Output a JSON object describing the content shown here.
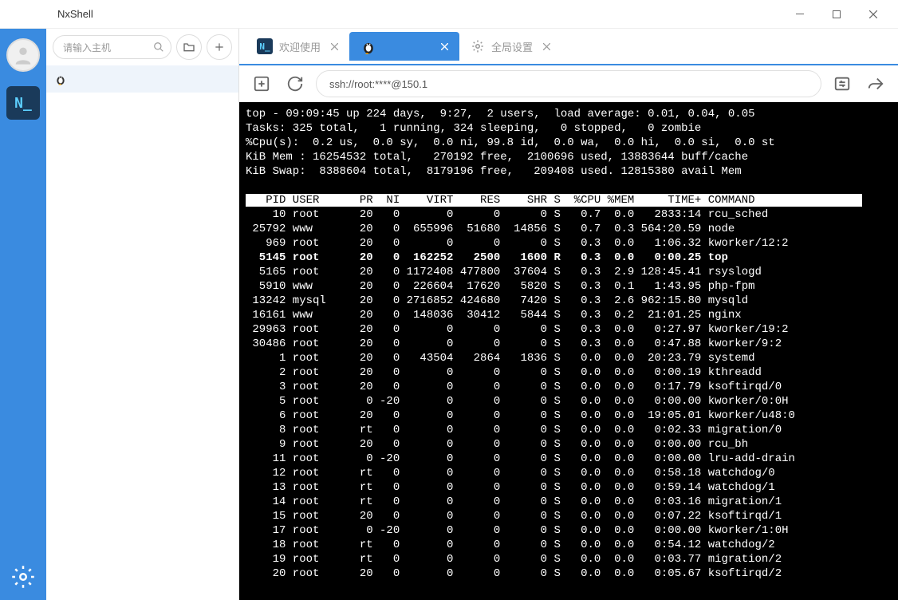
{
  "window": {
    "title": "NxShell"
  },
  "hostpanel": {
    "search_placeholder": "请输入主机",
    "host_item": ""
  },
  "tabs": {
    "welcome": "欢迎使用",
    "session": "",
    "global": "全局设置"
  },
  "address": "ssh://root:****@150.1",
  "term": {
    "summary1": "top - 09:09:45 up 224 days,  9:27,  2 users,  load average: 0.01, 0.04, 0.05",
    "summary2": "Tasks: 325 total,   1 running, 324 sleeping,   0 stopped,   0 zombie",
    "summary3": "%Cpu(s):  0.2 us,  0.0 sy,  0.0 ni, 99.8 id,  0.0 wa,  0.0 hi,  0.0 si,  0.0 st",
    "summary4": "KiB Mem : 16254532 total,   270192 free,  2100696 used, 13883644 buff/cache",
    "summary5": "KiB Swap:  8388604 total,  8179196 free,   209408 used. 12815380 avail Mem",
    "header": "   PID USER      PR  NI    VIRT    RES    SHR S  %CPU %MEM     TIME+ COMMAND                ",
    "rows": [
      "    10 root      20   0       0      0      0 S   0.7  0.0   2833:14 rcu_sched",
      " 25792 www       20   0  655996  51680  14856 S   0.7  0.3 564:20.59 node",
      "   969 root      20   0       0      0      0 S   0.3  0.0   1:06.32 kworker/12:2",
      "  5145 root      20   0  162252   2500   1600 R   0.3  0.0   0:00.25 top",
      "  5165 root      20   0 1172408 477800  37604 S   0.3  2.9 128:45.41 rsyslogd",
      "  5910 www       20   0  226604  17620   5820 S   0.3  0.1   1:43.95 php-fpm",
      " 13242 mysql     20   0 2716852 424680   7420 S   0.3  2.6 962:15.80 mysqld",
      " 16161 www       20   0  148036  30412   5844 S   0.3  0.2  21:01.25 nginx",
      " 29963 root      20   0       0      0      0 S   0.3  0.0   0:27.97 kworker/19:2",
      " 30486 root      20   0       0      0      0 S   0.3  0.0   0:47.88 kworker/9:2",
      "     1 root      20   0   43504   2864   1836 S   0.0  0.0  20:23.79 systemd",
      "     2 root      20   0       0      0      0 S   0.0  0.0   0:00.19 kthreadd",
      "     3 root      20   0       0      0      0 S   0.0  0.0   0:17.79 ksoftirqd/0",
      "     5 root       0 -20       0      0      0 S   0.0  0.0   0:00.00 kworker/0:0H",
      "     6 root      20   0       0      0      0 S   0.0  0.0  19:05.01 kworker/u48:0",
      "     8 root      rt   0       0      0      0 S   0.0  0.0   0:02.33 migration/0",
      "     9 root      20   0       0      0      0 S   0.0  0.0   0:00.00 rcu_bh",
      "    11 root       0 -20       0      0      0 S   0.0  0.0   0:00.00 lru-add-drain",
      "    12 root      rt   0       0      0      0 S   0.0  0.0   0:58.18 watchdog/0",
      "    13 root      rt   0       0      0      0 S   0.0  0.0   0:59.14 watchdog/1",
      "    14 root      rt   0       0      0      0 S   0.0  0.0   0:03.16 migration/1",
      "    15 root      20   0       0      0      0 S   0.0  0.0   0:07.22 ksoftirqd/1",
      "    17 root       0 -20       0      0      0 S   0.0  0.0   0:00.00 kworker/1:0H",
      "    18 root      rt   0       0      0      0 S   0.0  0.0   0:54.12 watchdog/2",
      "    19 root      rt   0       0      0      0 S   0.0  0.0   0:03.77 migration/2",
      "    20 root      20   0       0      0      0 S   0.0  0.0   0:05.67 ksoftirqd/2"
    ],
    "highlight_index": 3
  }
}
